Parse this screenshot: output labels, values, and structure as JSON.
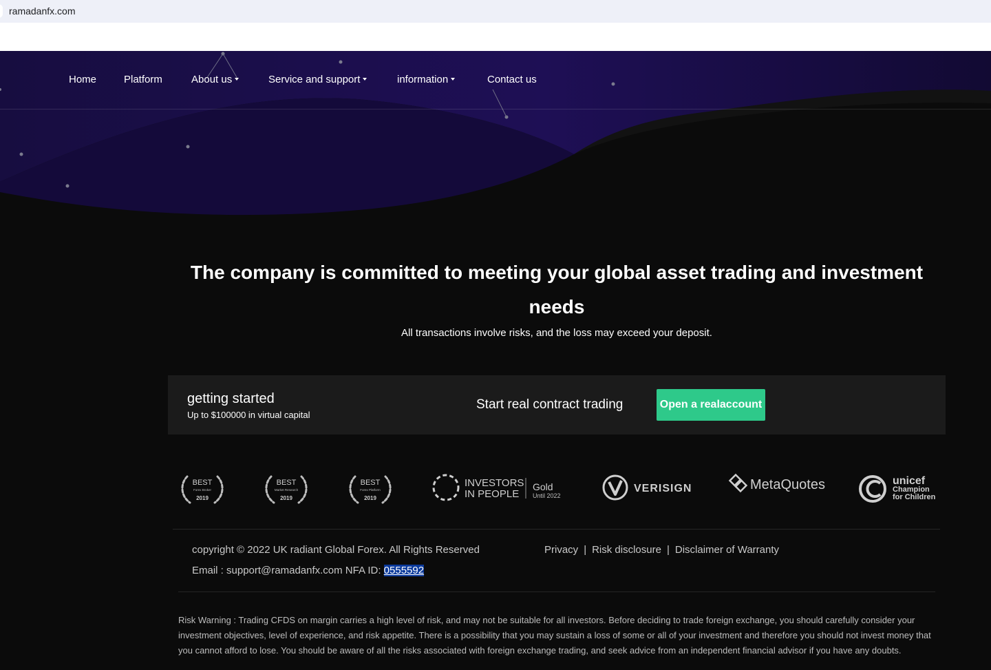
{
  "browser": {
    "url": "ramadanfx.com"
  },
  "nav": {
    "items": [
      {
        "label": "Home",
        "dropdown": false
      },
      {
        "label": "Platform",
        "dropdown": false
      },
      {
        "label": "About us",
        "dropdown": true
      },
      {
        "label": "Service and support",
        "dropdown": true
      },
      {
        "label": "information",
        "dropdown": true
      },
      {
        "label": "Contact us",
        "dropdown": false
      }
    ]
  },
  "hero": {
    "headline": "The company is committed to meeting your global asset trading and investment needs",
    "subline": "All transactions involve risks, and the loss may exceed your deposit."
  },
  "cta": {
    "title": "getting started",
    "subtitle": "Up to $100000 in virtual capital",
    "middle": "Start real contract trading",
    "button": "Open a realaccount",
    "button_color": "#2ec98a"
  },
  "logos": {
    "awards": [
      {
        "best": "BEST",
        "category": "Forex Broker",
        "year": "2019"
      },
      {
        "best": "BEST",
        "category": "Market Research",
        "year": "2019"
      },
      {
        "best": "BEST",
        "category": "Forex Platform",
        "year": "2019"
      }
    ],
    "iip": {
      "line1": "INVESTORS",
      "line2": "IN PEOPLE",
      "gold": "Gold",
      "until": "Until 2022"
    },
    "verisign": "VERISIGN",
    "metaquotes": "MetaQuotes",
    "unicef": {
      "name": "unicef",
      "line1": "Champion",
      "line2": "for Children"
    }
  },
  "footer": {
    "copyright": "copyright © 2022 UK radiant Global Forex. All Rights Reserved",
    "email_prefix": "Email : support@ramadanfx.com NFA ID: ",
    "nfa_id": "0555592",
    "links": [
      "Privacy",
      "Risk disclosure",
      "Disclaimer of Warranty"
    ],
    "risk_warning": "Risk Warning : Trading CFDS on margin carries a high level of risk, and may not be suitable for all investors. Before deciding to trade foreign exchange, you should carefully consider your investment objectives, level of experience, and risk appetite. There is a possibility that you may sustain a loss of some or all of your investment and therefore you should not invest money that you cannot afford to lose. You should be aware of all the risks associated with foreign exchange trading, and seek advice from an independent financial advisor if you have any doubts."
  },
  "colors": {
    "background": "#0b0b0b",
    "hero_purple": "#180c45",
    "hero_dark_purple": "#120a33"
  }
}
